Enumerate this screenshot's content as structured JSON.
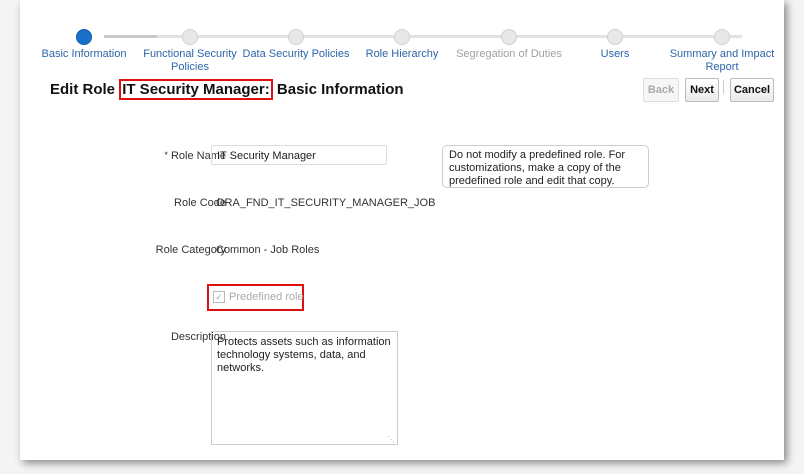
{
  "train": {
    "steps": [
      {
        "label": "Basic Information",
        "state": "active"
      },
      {
        "label": "Functional Security Policies",
        "state": "enabled"
      },
      {
        "label": "Data Security Policies",
        "state": "enabled"
      },
      {
        "label": "Role Hierarchy",
        "state": "enabled"
      },
      {
        "label": "Segregation of Duties",
        "state": "disabled"
      },
      {
        "label": "Users",
        "state": "enabled"
      },
      {
        "label": "Summary and Impact Report",
        "state": "enabled"
      }
    ]
  },
  "header": {
    "prefix": "Edit Role",
    "role": "IT Security Manager:",
    "suffix": "Basic Information"
  },
  "buttons": {
    "back": "Back",
    "next": "Next",
    "cancel": "Cancel"
  },
  "form": {
    "role_name_label": "Role Name",
    "required_mark": "*",
    "role_name_value": "IT Security Manager",
    "note": "Do not modify a predefined role. For customizations, make a copy of the predefined role and edit that copy.",
    "role_code_label": "Role Code",
    "role_code_value": "ORA_FND_IT_SECURITY_MANAGER_JOB",
    "role_category_label": "Role Category",
    "role_category_value": "Common - Job Roles",
    "predefined_label": "Predefined role",
    "predefined_checked": true,
    "description_label": "Description",
    "description_value": "Protects assets such as information technology systems, data, and networks."
  }
}
